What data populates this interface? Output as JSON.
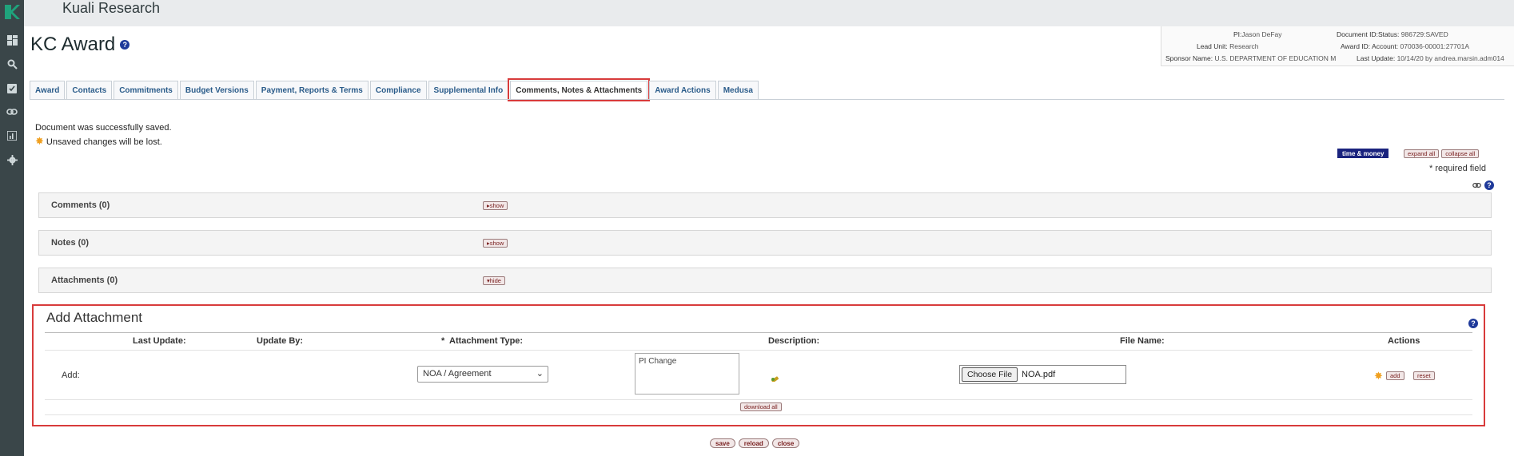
{
  "app": {
    "brand": "Kuali Research"
  },
  "page": {
    "title": "KC Award"
  },
  "info": {
    "pi_label": "PI:",
    "pi_value": "Jason DeFay",
    "unit_label": "Lead Unit:",
    "unit_value": "Research",
    "sponsor_label": "Sponsor Name:",
    "sponsor_value": "U.S. DEPARTMENT OF EDUCATION M",
    "docid_label": "Document ID:Status:",
    "docid_value": "986729:SAVED",
    "awardid_label": "Award ID: Account:",
    "awardid_value": "070036-00001:27701A",
    "update_label": "Last Update:",
    "update_value": "10/14/20 by andrea.marsin.adm014"
  },
  "tabs": [
    "Award",
    "Contacts",
    "Commitments",
    "Budget Versions",
    "Payment, Reports & Terms",
    "Compliance",
    "Supplemental Info",
    "Comments, Notes & Attachments",
    "Award Actions",
    "Medusa"
  ],
  "messages": {
    "saved": "Document was successfully saved.",
    "unsaved": "Unsaved changes will be lost."
  },
  "toolbar": {
    "time_money": "time & money",
    "expand_all": "expand all",
    "collapse_all": "collapse all",
    "required": "* required field"
  },
  "panels": [
    {
      "title": "Comments (0)",
      "toggle": "show"
    },
    {
      "title": "Notes (0)",
      "toggle": "show"
    },
    {
      "title": "Attachments (0)",
      "toggle": "hide"
    }
  ],
  "add_attachment": {
    "heading": "Add Attachment",
    "headers": {
      "last_update": "Last Update:",
      "update_by": "Update By:",
      "req_mark": "*",
      "type": "Attachment Type:",
      "description": "Description:",
      "file_name": "File Name:",
      "actions": "Actions"
    },
    "row_label": "Add:",
    "type_value": "NOA / Agreement",
    "description_value": "PI Change",
    "choose_file": "Choose File",
    "file_value": "NOA.pdf",
    "add_btn": "add",
    "reset_btn": "reset",
    "download_all": "download all"
  },
  "footer": {
    "save": "save",
    "reload": "reload",
    "close": "close"
  },
  "colors": {
    "highlight": "#d83b3b",
    "tab_text": "#2b5c8a",
    "rail": "#3a4649",
    "logo": "#1fa37c"
  }
}
